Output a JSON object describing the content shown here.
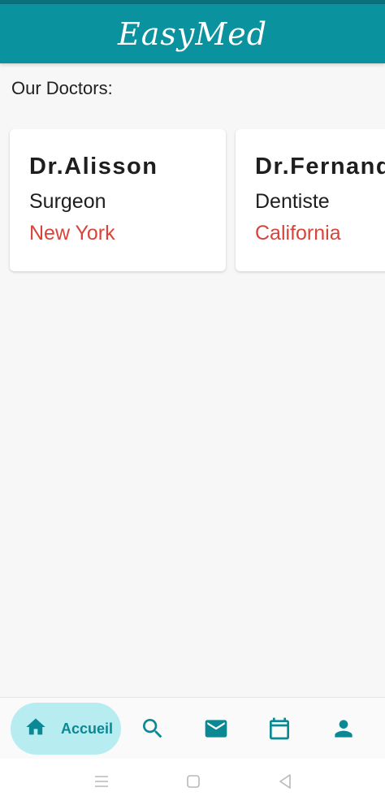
{
  "app": {
    "title": "EasyMed"
  },
  "section": {
    "title": "Our Doctors:"
  },
  "doctors": [
    {
      "name": "Dr.Alisson",
      "specialty": "Surgeon",
      "city": "New York"
    },
    {
      "name": "Dr.Fernando",
      "specialty": "Dentiste",
      "city": "California"
    }
  ],
  "bottom_nav": {
    "items": [
      {
        "label": "Accueil",
        "icon": "home-icon",
        "active": true
      },
      {
        "label": "",
        "icon": "search-icon"
      },
      {
        "label": "",
        "icon": "mail-icon"
      },
      {
        "label": "",
        "icon": "calendar-icon"
      },
      {
        "label": "",
        "icon": "person-icon"
      }
    ]
  },
  "colors": {
    "primary": "#0a929f",
    "accent_text": "#d9443a",
    "nav_active_bg": "#b7ecf0"
  }
}
